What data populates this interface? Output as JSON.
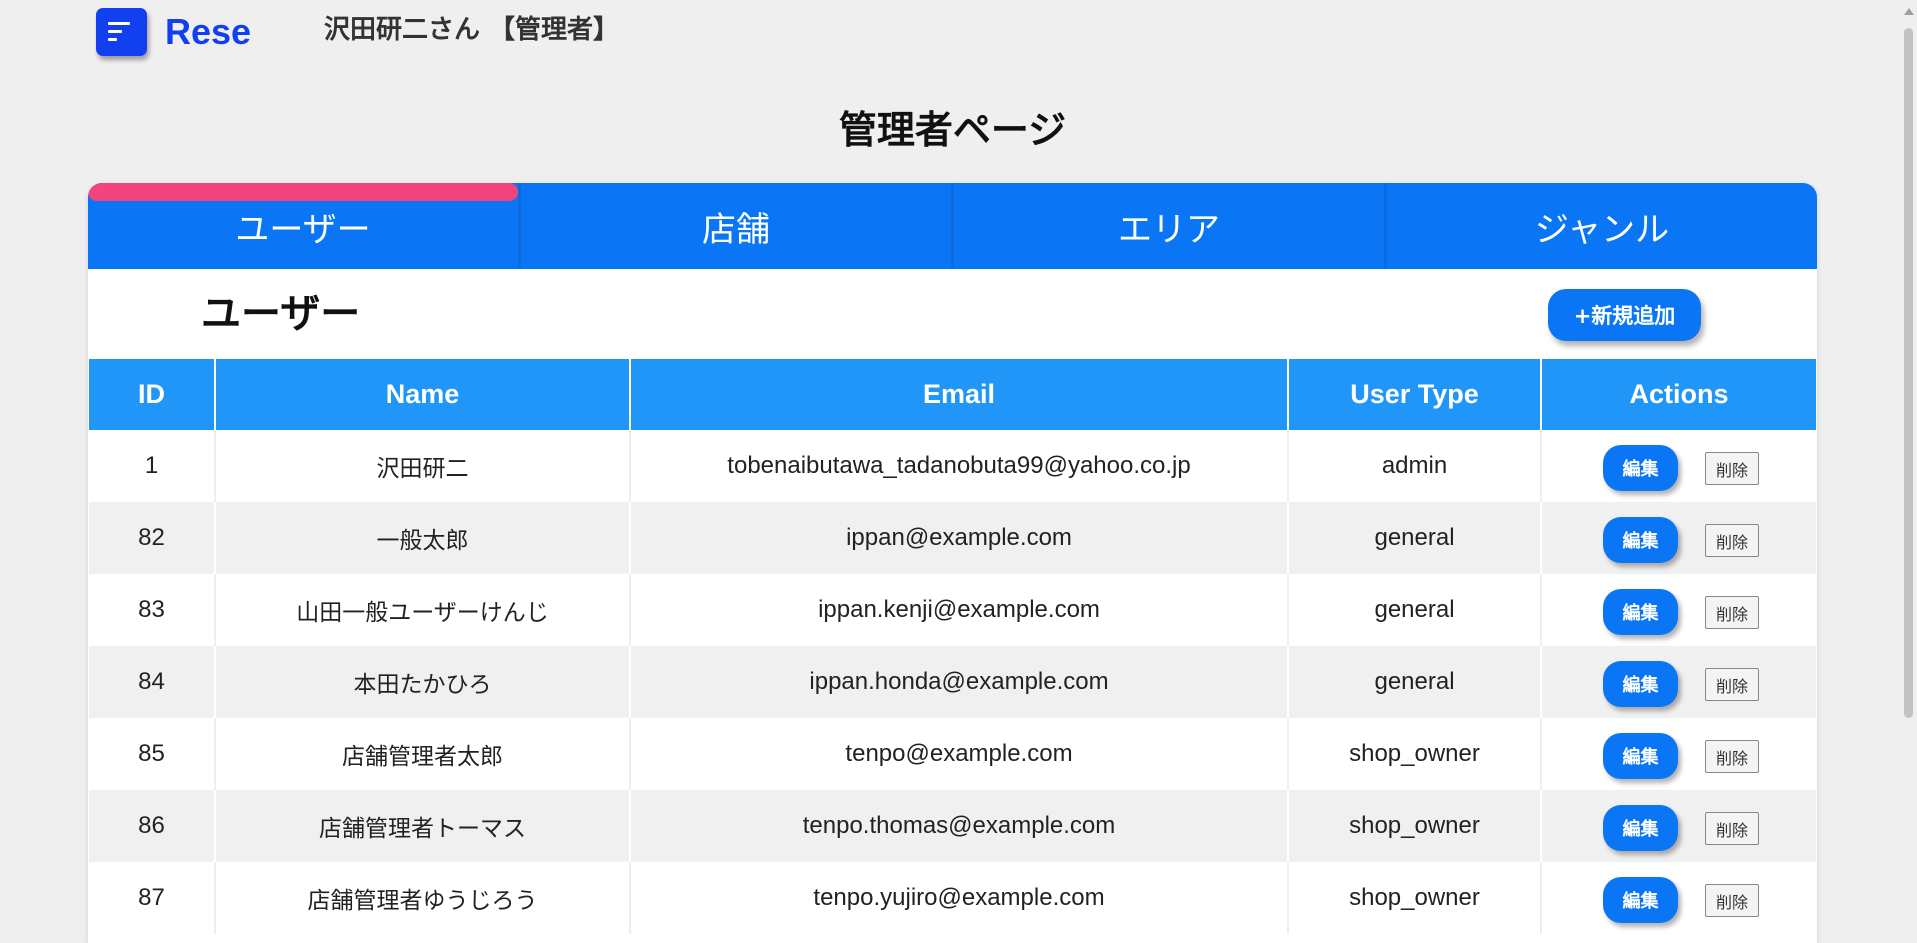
{
  "header": {
    "brand": "Rese",
    "user_name": "沢田研二さん 【管理者】"
  },
  "page": {
    "title": "管理者ページ"
  },
  "tabs": [
    {
      "label": "ユーザー",
      "active": true
    },
    {
      "label": "店舗",
      "active": false
    },
    {
      "label": "エリア",
      "active": false
    },
    {
      "label": "ジャンル",
      "active": false
    }
  ],
  "section": {
    "title": "ユーザー",
    "add_button": "+新規追加"
  },
  "table": {
    "columns": [
      "ID",
      "Name",
      "Email",
      "User Type",
      "Actions"
    ],
    "edit_label": "編集",
    "delete_label": "削除",
    "rows": [
      {
        "id": "1",
        "name": "沢田研二",
        "email": "tobenaibutawa_tadanobuta99@yahoo.co.jp",
        "type": "admin"
      },
      {
        "id": "82",
        "name": "一般太郎",
        "email": "ippan@example.com",
        "type": "general"
      },
      {
        "id": "83",
        "name": "山田一般ユーザーけんじ",
        "email": "ippan.kenji@example.com",
        "type": "general"
      },
      {
        "id": "84",
        "name": "本田たかひろ",
        "email": "ippan.honda@example.com",
        "type": "general"
      },
      {
        "id": "85",
        "name": "店舗管理者太郎",
        "email": "tenpo@example.com",
        "type": "shop_owner"
      },
      {
        "id": "86",
        "name": "店舗管理者トーマス",
        "email": "tenpo.thomas@example.com",
        "type": "shop_owner"
      },
      {
        "id": "87",
        "name": "店舗管理者ゆうじろう",
        "email": "tenpo.yujiro@example.com",
        "type": "shop_owner"
      }
    ]
  },
  "colors": {
    "brand": "#1240f0",
    "tab_bar": "#0a76f5",
    "active_indicator": "#f2457e",
    "table_header": "#2196f9"
  },
  "icons": {
    "menu": "hamburger-menu-icon"
  }
}
